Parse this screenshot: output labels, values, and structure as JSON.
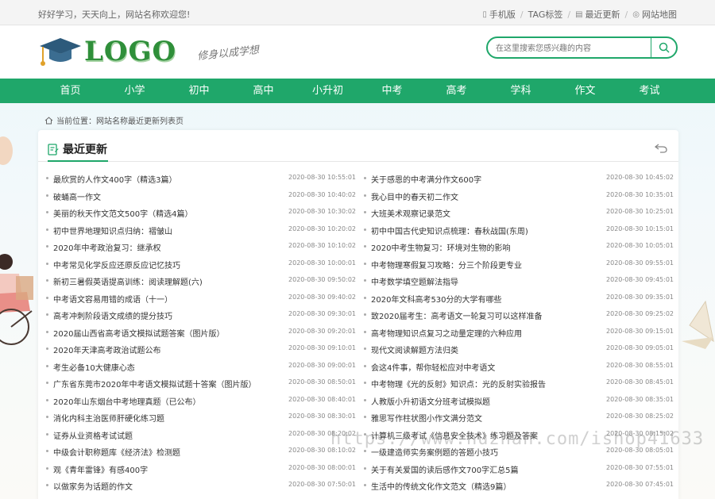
{
  "topbar": {
    "welcome": "好好学习，天天向上，网站名称欢迎您!",
    "links": [
      {
        "label": "手机版",
        "icon": "mobile-icon"
      },
      {
        "label": "TAG标签",
        "icon": ""
      },
      {
        "label": "最近更新",
        "icon": "doc-icon"
      },
      {
        "label": "网站地图",
        "icon": "map-pin-icon"
      }
    ]
  },
  "header": {
    "logo_text": "LOGO",
    "slogan": "修身以成学想",
    "search_placeholder": "在这里搜索您感兴趣的内容"
  },
  "nav": [
    "首页",
    "小学",
    "初中",
    "高中",
    "小升初",
    "中考",
    "高考",
    "学科",
    "作文",
    "考试"
  ],
  "breadcrumb": "当前位置：网站名称最近更新列表页",
  "panel": {
    "title": "最近更新"
  },
  "left_items": [
    {
      "title": "最欣赏的人作文400字（精选3篇）",
      "date": "2020-08-30 10:55:01"
    },
    {
      "title": "破蛹高一作文",
      "date": "2020-08-30 10:40:02"
    },
    {
      "title": "美丽的秋天作文范文500字（精选4篇）",
      "date": "2020-08-30 10:30:02"
    },
    {
      "title": "初中世界地理知识点归纳：褶皱山",
      "date": "2020-08-30 10:20:02"
    },
    {
      "title": "2020年中考政治复习：继承权",
      "date": "2020-08-30 10:10:02"
    },
    {
      "title": "中考常见化学反应还原反应记忆技巧",
      "date": "2020-08-30 10:00:01"
    },
    {
      "title": "新初三暑假英语提高训练：阅读理解题(六)",
      "date": "2020-08-30 09:50:02"
    },
    {
      "title": "中考语文容易用错的成语（十一）",
      "date": "2020-08-30 09:40:02"
    },
    {
      "title": "高考冲刺阶段语文成绩的提分技巧",
      "date": "2020-08-30 09:30:01"
    },
    {
      "title": "2020届山西省高考语文模拟试题答案（图片版）",
      "date": "2020-08-30 09:20:01"
    },
    {
      "title": "2020年天津高考政治试题公布",
      "date": "2020-08-30 09:10:01"
    },
    {
      "title": "考生必备10大健康心态",
      "date": "2020-08-30 09:00:01"
    },
    {
      "title": "广东省东莞市2020年中考语文模拟试题十答案（图片版）",
      "date": "2020-08-30 08:50:01"
    },
    {
      "title": "2020年山东烟台中考地理真题（已公布）",
      "date": "2020-08-30 08:40:01"
    },
    {
      "title": "消化内科主治医师肝硬化练习题",
      "date": "2020-08-30 08:30:01"
    },
    {
      "title": "证券从业资格考试试题",
      "date": "2020-08-30 08:20:02"
    },
    {
      "title": "中级会计职称题库《经济法》检测题",
      "date": "2020-08-30 08:10:02"
    },
    {
      "title": "观《青年雷锋》有感400字",
      "date": "2020-08-30 08:00:01"
    },
    {
      "title": "以做家务为话题的作文",
      "date": "2020-08-30 07:50:01"
    }
  ],
  "right_items": [
    {
      "title": "关于感恩的中考满分作文600字",
      "date": "2020-08-30 10:45:02"
    },
    {
      "title": "我心目中的春天初二作文",
      "date": "2020-08-30 10:35:01"
    },
    {
      "title": "大班美术观察记录范文",
      "date": "2020-08-30 10:25:01"
    },
    {
      "title": "初中中国古代史知识点梳理：春秋战国(东周)",
      "date": "2020-08-30 10:15:01"
    },
    {
      "title": "2020中考生物复习：环境对生物的影响",
      "date": "2020-08-30 10:05:01"
    },
    {
      "title": "中考物理寒假复习攻略：分三个阶段更专业",
      "date": "2020-08-30 09:55:01"
    },
    {
      "title": "中考数学填空题解法指导",
      "date": "2020-08-30 09:45:01"
    },
    {
      "title": "2020年文科高考530分的大学有哪些",
      "date": "2020-08-30 09:35:01"
    },
    {
      "title": "致2020届考生：高考语文一轮复习可以这样准备",
      "date": "2020-08-30 09:25:02"
    },
    {
      "title": "高考物理知识点复习之动量定理的六种应用",
      "date": "2020-08-30 09:15:01"
    },
    {
      "title": "现代文阅读解题方法归类",
      "date": "2020-08-30 09:05:01"
    },
    {
      "title": "会这4件事，帮你轻松应对中考语文",
      "date": "2020-08-30 08:55:01"
    },
    {
      "title": "中考物理《光的反射》知识点：光的反射实验报告",
      "date": "2020-08-30 08:45:01"
    },
    {
      "title": "人教版小升初语文分班考试模拟题",
      "date": "2020-08-30 08:35:01"
    },
    {
      "title": "雅思写作柱状图小作文满分范文",
      "date": "2020-08-30 08:25:02"
    },
    {
      "title": "计算机三级考试《信息安全技术》练习题及答案",
      "date": "2020-08-30 08:15:02"
    },
    {
      "title": "一级建造师实务案例题的答题小技巧",
      "date": "2020-08-30 08:05:01"
    },
    {
      "title": "关于有关爱国的读后感作文700字汇总5篇",
      "date": "2020-08-30 07:55:01"
    },
    {
      "title": "生活中的传统文化作文范文（精选9篇）",
      "date": "2020-08-30 07:45:01"
    }
  ],
  "watermark": "https://www.huzhan.com/ishop41633",
  "colors": {
    "accent": "#1fa76a",
    "logo_green": "#2f8f3a"
  }
}
